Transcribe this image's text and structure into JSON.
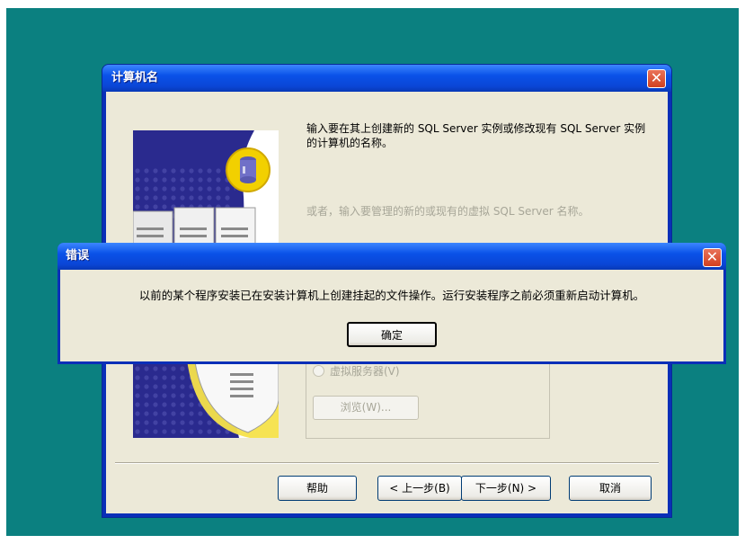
{
  "main_window": {
    "title": "计算机名",
    "intro_text": "输入要在其上创建新的 SQL Server 实例或修改现有 SQL Server 实例的计算机的名称。",
    "or_text": "或者，输入要管理的新的或现有的虚拟 SQL Server 名称。",
    "radio_virtual_label": "虚拟服务器(V)",
    "browse_label": "浏览(W)...",
    "buttons": {
      "help": "帮助",
      "back": "< 上一步(B)",
      "next": "下一步(N) >",
      "cancel": "取消"
    }
  },
  "error_dialog": {
    "title": "错误",
    "message": "以前的某个程序安装已在安装计算机上创建挂起的文件操作。运行安装程序之前必须重新启动计算机。",
    "ok_label": "确定"
  },
  "icons": {
    "close": "close-icon",
    "server_art": "server-illustration-icon",
    "database": "database-icon"
  },
  "colors": {
    "desktop": "#0b8080",
    "titlebar": "#0a52e8",
    "dialog_face": "#ece9d8",
    "close_button": "#d2401f",
    "disabled_text": "#a7a698"
  }
}
